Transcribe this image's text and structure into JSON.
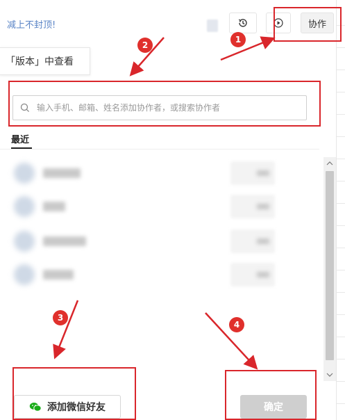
{
  "toolbar": {
    "notice": "减上不封顶!",
    "collab_label": "协作",
    "history_icon": "history-icon",
    "play_icon": "play-icon"
  },
  "hint": {
    "text": "「版本」中查看"
  },
  "search": {
    "placeholder": "输入手机、邮箱、姓名添加协作者，或搜索协作者",
    "icon": "search-icon"
  },
  "tabs": {
    "recent": "最近"
  },
  "contacts": {
    "count_shown": 4
  },
  "actions": {
    "wechat_label": "添加微信好友",
    "confirm_label": "确定"
  },
  "annotations": {
    "step1": "1",
    "step2": "2",
    "step3": "3",
    "step4": "4"
  },
  "colors": {
    "annotation_red": "#d9262b",
    "notice_blue": "#5a84c6",
    "wechat_green": "#1aad19",
    "confirm_disabled": "#cfcfcf"
  }
}
